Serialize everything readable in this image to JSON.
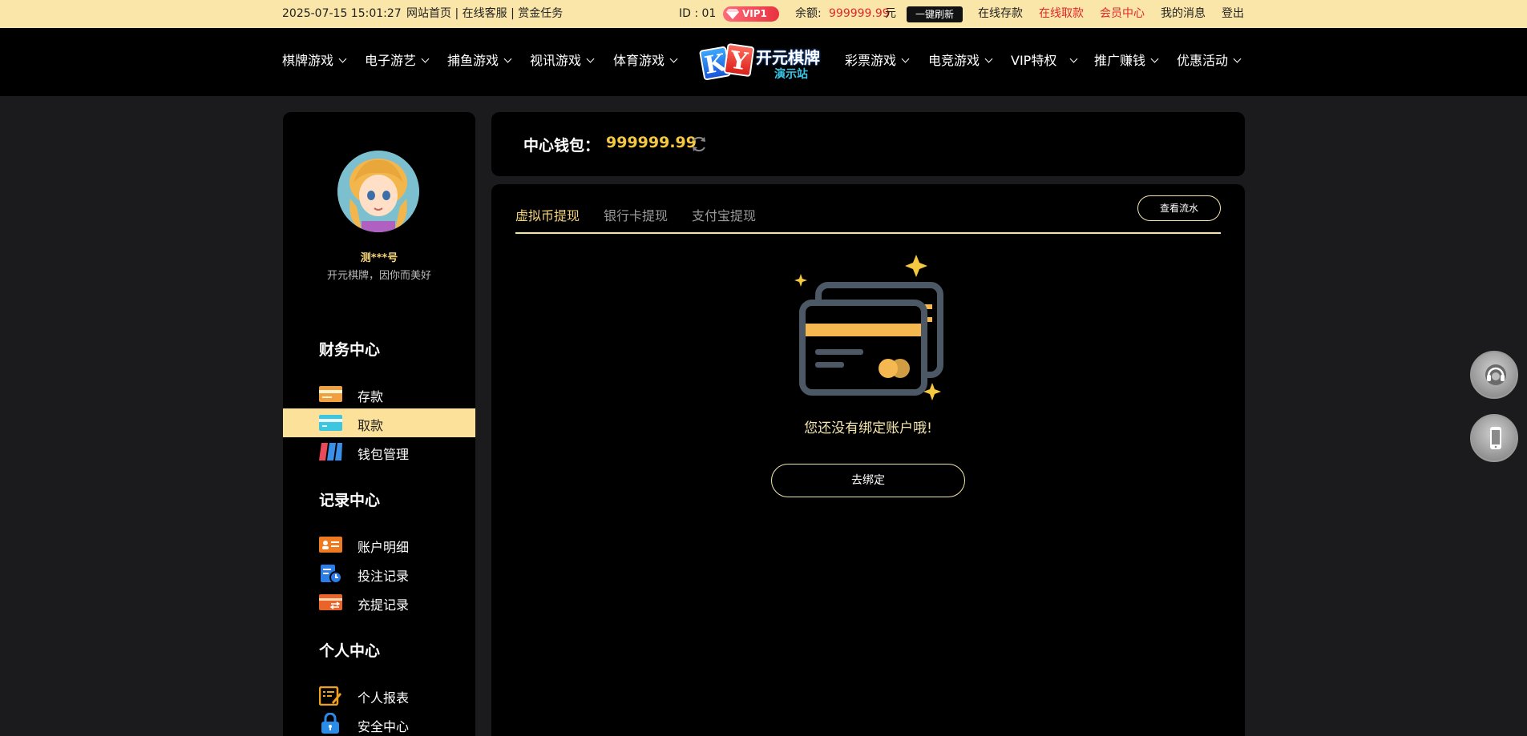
{
  "topbar": {
    "datetime": "2025-07-15 15:01:27",
    "quick_links": "网站首页 | 在线客服 | 赏金任务",
    "id_text": "ID : 01",
    "vip_level": "VIP1",
    "balance_label": "余额:",
    "balance_value": "999999.99",
    "balance_unit": "元",
    "refresh_label": "一键刷新",
    "links": [
      "在线存款",
      "在线取款",
      "会员中心",
      "我的消息",
      "登出"
    ]
  },
  "nav": {
    "left_items": [
      "棋牌游戏",
      "电子游艺",
      "捕鱼游戏",
      "视讯游戏",
      "体育游戏"
    ],
    "right_items": [
      "彩票游戏",
      "电竞游戏",
      "VIP特权",
      "推广赚钱",
      "优惠活动"
    ],
    "logo": {
      "letters": [
        "K",
        "Y"
      ],
      "name": "开元棋牌",
      "sub": "演示站"
    }
  },
  "sidebar": {
    "user_name": "测***号",
    "motto": "开元棋牌，因你而美好",
    "sections": [
      {
        "title": "财务中心",
        "items": [
          {
            "label": "存款",
            "icon": "deposit-icon",
            "active": false
          },
          {
            "label": "取款",
            "icon": "withdraw-icon",
            "active": true
          },
          {
            "label": "钱包管理",
            "icon": "wallet-icon",
            "active": false
          }
        ]
      },
      {
        "title": "记录中心",
        "items": [
          {
            "label": "账户明细",
            "icon": "account-detail-icon",
            "active": false
          },
          {
            "label": "投注记录",
            "icon": "bet-record-icon",
            "active": false
          },
          {
            "label": "充提记录",
            "icon": "transaction-record-icon",
            "active": false
          }
        ]
      },
      {
        "title": "个人中心",
        "items": [
          {
            "label": "个人报表",
            "icon": "report-icon",
            "active": false
          },
          {
            "label": "安全中心",
            "icon": "security-icon",
            "active": false
          }
        ]
      }
    ]
  },
  "wallet": {
    "label": "中心钱包：",
    "amount": "999999.99"
  },
  "panel": {
    "tabs": [
      "虚拟币提现",
      "银行卡提现",
      "支付宝提现"
    ],
    "active_tab": 0,
    "flow_button": "查看流水",
    "empty_text": "您还没有绑定账户哦!",
    "bind_button": "去绑定"
  },
  "colors": {
    "accent_gold": "#f5d47a",
    "topbar_bg": "#fbe6a9",
    "active_red": "#e0262b"
  }
}
